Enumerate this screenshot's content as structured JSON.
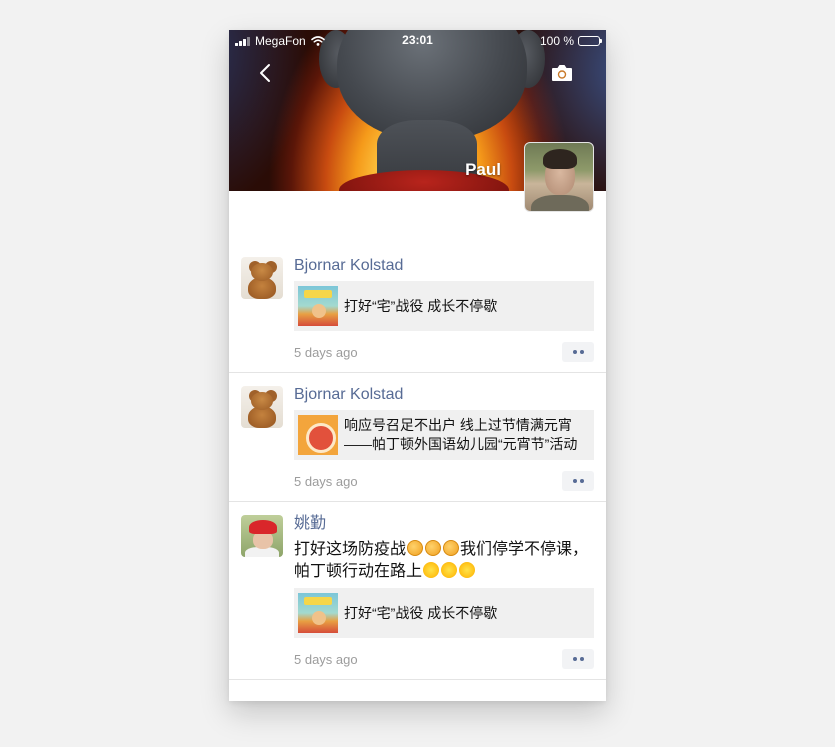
{
  "status_bar": {
    "carrier": "MegaFon",
    "time": "23:01",
    "battery": "100 %"
  },
  "header": {
    "profile_name": "Paul",
    "back_icon": "chevron-left-icon",
    "camera_icon": "camera-icon"
  },
  "posts": [
    {
      "author": "Bjornar Kolstad",
      "text": "",
      "share_title": "打好“宅”战役   成长不停歇",
      "time": "5 days ago"
    },
    {
      "author": "Bjornar Kolstad",
      "text": "",
      "share_title": "响应号召足不出户   线上过节情满元宵\n——帕丁顿外国语幼儿园“元宵节”活动",
      "time": "5 days ago"
    },
    {
      "author": "姚勤",
      "text_part1": "打好这场防疫战",
      "text_part2": "我们停学不停课，帕丁顿行动在路上",
      "share_title": "打好“宅”战役   成长不停歇",
      "time": "5 days ago"
    }
  ],
  "colors": {
    "link_blue": "#576b95",
    "timestamp_gray": "#9c9c9c",
    "share_bg": "#f0f0f0"
  }
}
